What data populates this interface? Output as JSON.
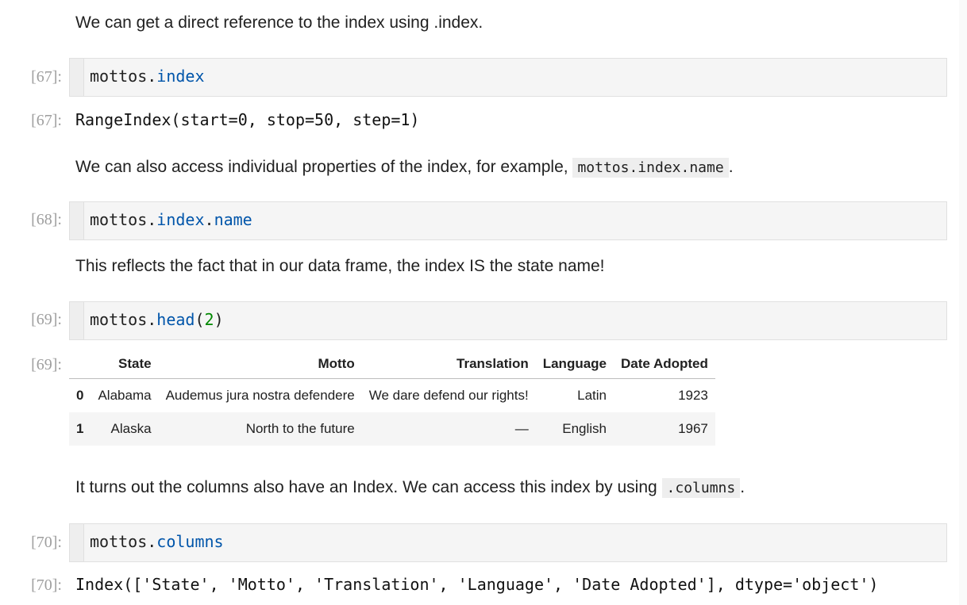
{
  "md1": "We can get a direct reference to the index using .index.",
  "cells": [
    {
      "prompt": "[67]:",
      "obj": "mottos",
      "dot": ".",
      "attr": "index"
    },
    {
      "prompt": "[68]:",
      "obj": "mottos",
      "dot": ".",
      "attr": "index",
      "dot2": ".",
      "attr2": "name"
    },
    {
      "prompt": "[69]:",
      "obj": "mottos",
      "dot": ".",
      "attr": "head",
      "open": "(",
      "arg": "2",
      "close": ")"
    },
    {
      "prompt": "[70]:",
      "obj": "mottos",
      "dot": ".",
      "attr": "columns"
    }
  ],
  "outputs": [
    {
      "prompt": "[67]:",
      "text": "RangeIndex(start=0, stop=50, step=1)"
    },
    {
      "prompt": "[69]:"
    },
    {
      "prompt": "[70]:",
      "text": "Index(['State', 'Motto', 'Translation', 'Language', 'Date Adopted'], dtype='object')"
    }
  ],
  "md2": {
    "before": "We can also access individual properties of the index, for example,",
    "code": "mottos.index.name",
    "after": "."
  },
  "md3": "This reflects the fact that in our data frame, the index IS the state name!",
  "md4": {
    "before": "It turns out the columns also have an Index. We can access this index by using",
    "code": ".columns",
    "after": "."
  },
  "table": {
    "headers": [
      "",
      "State",
      "Motto",
      "Translation",
      "Language",
      "Date Adopted"
    ],
    "rows": [
      [
        "0",
        "Alabama",
        "Audemus jura nostra defendere",
        "We dare defend our rights!",
        "Latin",
        "1923"
      ],
      [
        "1",
        "Alaska",
        "North to the future",
        "—",
        "English",
        "1967"
      ]
    ]
  }
}
